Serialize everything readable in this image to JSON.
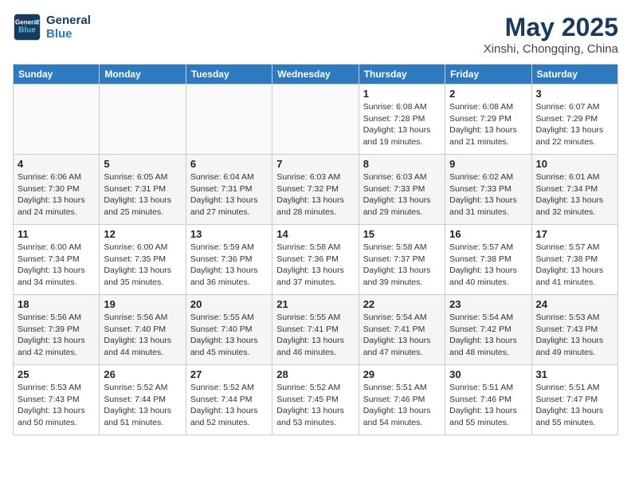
{
  "header": {
    "logo_line1": "General",
    "logo_line2": "Blue",
    "month": "May 2025",
    "location": "Xinshi, Chongqing, China"
  },
  "weekdays": [
    "Sunday",
    "Monday",
    "Tuesday",
    "Wednesday",
    "Thursday",
    "Friday",
    "Saturday"
  ],
  "weeks": [
    [
      {
        "day": "",
        "info": ""
      },
      {
        "day": "",
        "info": ""
      },
      {
        "day": "",
        "info": ""
      },
      {
        "day": "",
        "info": ""
      },
      {
        "day": "1",
        "info": "Sunrise: 6:08 AM\nSunset: 7:28 PM\nDaylight: 13 hours\nand 19 minutes."
      },
      {
        "day": "2",
        "info": "Sunrise: 6:08 AM\nSunset: 7:29 PM\nDaylight: 13 hours\nand 21 minutes."
      },
      {
        "day": "3",
        "info": "Sunrise: 6:07 AM\nSunset: 7:29 PM\nDaylight: 13 hours\nand 22 minutes."
      }
    ],
    [
      {
        "day": "4",
        "info": "Sunrise: 6:06 AM\nSunset: 7:30 PM\nDaylight: 13 hours\nand 24 minutes."
      },
      {
        "day": "5",
        "info": "Sunrise: 6:05 AM\nSunset: 7:31 PM\nDaylight: 13 hours\nand 25 minutes."
      },
      {
        "day": "6",
        "info": "Sunrise: 6:04 AM\nSunset: 7:31 PM\nDaylight: 13 hours\nand 27 minutes."
      },
      {
        "day": "7",
        "info": "Sunrise: 6:03 AM\nSunset: 7:32 PM\nDaylight: 13 hours\nand 28 minutes."
      },
      {
        "day": "8",
        "info": "Sunrise: 6:03 AM\nSunset: 7:33 PM\nDaylight: 13 hours\nand 29 minutes."
      },
      {
        "day": "9",
        "info": "Sunrise: 6:02 AM\nSunset: 7:33 PM\nDaylight: 13 hours\nand 31 minutes."
      },
      {
        "day": "10",
        "info": "Sunrise: 6:01 AM\nSunset: 7:34 PM\nDaylight: 13 hours\nand 32 minutes."
      }
    ],
    [
      {
        "day": "11",
        "info": "Sunrise: 6:00 AM\nSunset: 7:34 PM\nDaylight: 13 hours\nand 34 minutes."
      },
      {
        "day": "12",
        "info": "Sunrise: 6:00 AM\nSunset: 7:35 PM\nDaylight: 13 hours\nand 35 minutes."
      },
      {
        "day": "13",
        "info": "Sunrise: 5:59 AM\nSunset: 7:36 PM\nDaylight: 13 hours\nand 36 minutes."
      },
      {
        "day": "14",
        "info": "Sunrise: 5:58 AM\nSunset: 7:36 PM\nDaylight: 13 hours\nand 37 minutes."
      },
      {
        "day": "15",
        "info": "Sunrise: 5:58 AM\nSunset: 7:37 PM\nDaylight: 13 hours\nand 39 minutes."
      },
      {
        "day": "16",
        "info": "Sunrise: 5:57 AM\nSunset: 7:38 PM\nDaylight: 13 hours\nand 40 minutes."
      },
      {
        "day": "17",
        "info": "Sunrise: 5:57 AM\nSunset: 7:38 PM\nDaylight: 13 hours\nand 41 minutes."
      }
    ],
    [
      {
        "day": "18",
        "info": "Sunrise: 5:56 AM\nSunset: 7:39 PM\nDaylight: 13 hours\nand 42 minutes."
      },
      {
        "day": "19",
        "info": "Sunrise: 5:56 AM\nSunset: 7:40 PM\nDaylight: 13 hours\nand 44 minutes."
      },
      {
        "day": "20",
        "info": "Sunrise: 5:55 AM\nSunset: 7:40 PM\nDaylight: 13 hours\nand 45 minutes."
      },
      {
        "day": "21",
        "info": "Sunrise: 5:55 AM\nSunset: 7:41 PM\nDaylight: 13 hours\nand 46 minutes."
      },
      {
        "day": "22",
        "info": "Sunrise: 5:54 AM\nSunset: 7:41 PM\nDaylight: 13 hours\nand 47 minutes."
      },
      {
        "day": "23",
        "info": "Sunrise: 5:54 AM\nSunset: 7:42 PM\nDaylight: 13 hours\nand 48 minutes."
      },
      {
        "day": "24",
        "info": "Sunrise: 5:53 AM\nSunset: 7:43 PM\nDaylight: 13 hours\nand 49 minutes."
      }
    ],
    [
      {
        "day": "25",
        "info": "Sunrise: 5:53 AM\nSunset: 7:43 PM\nDaylight: 13 hours\nand 50 minutes."
      },
      {
        "day": "26",
        "info": "Sunrise: 5:52 AM\nSunset: 7:44 PM\nDaylight: 13 hours\nand 51 minutes."
      },
      {
        "day": "27",
        "info": "Sunrise: 5:52 AM\nSunset: 7:44 PM\nDaylight: 13 hours\nand 52 minutes."
      },
      {
        "day": "28",
        "info": "Sunrise: 5:52 AM\nSunset: 7:45 PM\nDaylight: 13 hours\nand 53 minutes."
      },
      {
        "day": "29",
        "info": "Sunrise: 5:51 AM\nSunset: 7:46 PM\nDaylight: 13 hours\nand 54 minutes."
      },
      {
        "day": "30",
        "info": "Sunrise: 5:51 AM\nSunset: 7:46 PM\nDaylight: 13 hours\nand 55 minutes."
      },
      {
        "day": "31",
        "info": "Sunrise: 5:51 AM\nSunset: 7:47 PM\nDaylight: 13 hours\nand 55 minutes."
      }
    ]
  ]
}
